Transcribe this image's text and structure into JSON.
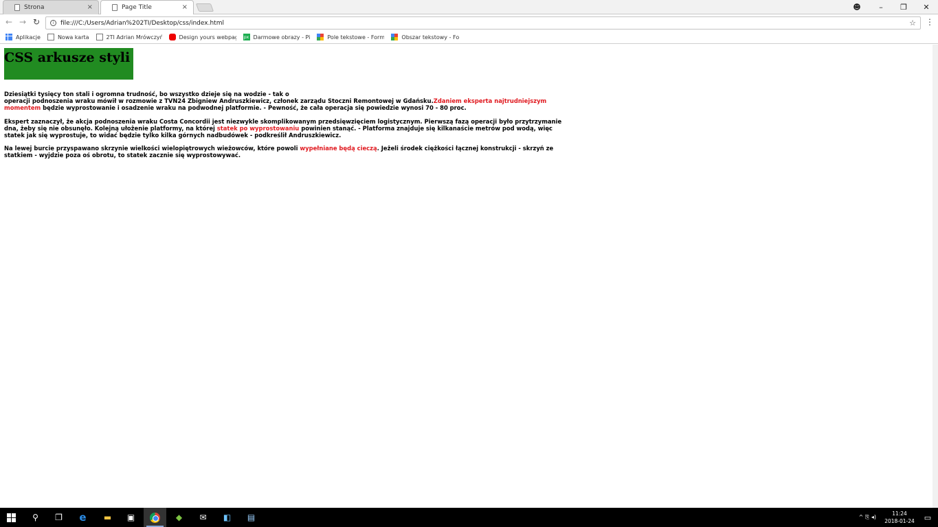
{
  "browser": {
    "tabs": [
      {
        "title": "Strona",
        "active": false
      },
      {
        "title": "Page Title",
        "active": true
      }
    ],
    "close_glyph": "×",
    "window_controls": {
      "account": "☻",
      "minimize": "–",
      "restore": "❐",
      "close": "✕"
    },
    "nav": {
      "back": "←",
      "forward": "→",
      "reload": "↻"
    },
    "address": {
      "info_glyph": "i",
      "url": "file:///C:/Users/Adrian%202TI/Desktop/css/index.html",
      "star": "☆"
    },
    "menu_glyph": "⋮",
    "bookmarks": [
      {
        "label": "Aplikacje",
        "icon": "apps-grid-icon"
      },
      {
        "label": "Nowa karta",
        "icon": "page-icon"
      },
      {
        "label": "2TI Adrian Mrówczyń",
        "icon": "page-icon"
      },
      {
        "label": "Design yours webpag",
        "icon": "youtube-icon"
      },
      {
        "label": "Darmowe obrazy - Pi",
        "icon": "pixabay-icon"
      },
      {
        "label": "Pole tekstowe - Form",
        "icon": "google-icon"
      },
      {
        "label": "Obszar tekstowy - Fo",
        "icon": "google-icon"
      }
    ]
  },
  "page": {
    "heading": "CSS arkusze styli",
    "heading_bg": "#218b21",
    "accent_red": "#e0191f",
    "paragraphs": [
      {
        "text_1": "Dziesiątki tysięcy ton stali i ogromna trudność, bo wszystko dzieje się na wodzie - tak o",
        "text_2": "operacji podnoszenia wraku mówił w rozmowie z TVN24 Zbigniew Andruszkiewicz, członek zarządu Stoczni Remontowej w Gdańsku.",
        "red": "Zdaniem eksperta najtrudniejszym momentem",
        "text_3": " będzie wyprostowanie i osadzenie wraku na podwodnej platformie. - Pewność, że cała operacja się powiedzie wynosi 70 - 80 proc."
      },
      {
        "text_1": "Ekspert zaznaczył, że akcja podnoszenia wraku Costa Concordii jest niezwykle skomplikowanym przedsięwzięciem logistycznym. Pierwszą fazą operacji było przytrzymanie dna, żeby się nie obsunęło. Kolejną ułożenie platformy, na której ",
        "red": "statek po wyprostowaniu",
        "text_2": " powinien stanąć. - Platforma znajduje się kilkanaście metrów pod wodą, więc statek jak się wyprostuje, to widać będzie tylko kilka górnych nadbudówek - podkreślił Andruszkiewicz."
      },
      {
        "text_1": "Na lewej burcie przyspawano skrzynie wielkości wielopiętrowych wieżowców, które powoli ",
        "red": "wypełniane będą cieczą",
        "text_2": ". Jeżeli środek ciężkości łącznej konstrukcji - skrzyń ze statkiem - wyjdzie poza oś obrotu, to statek zacznie się wyprostowywać."
      }
    ]
  },
  "taskbar": {
    "search_glyph": "⚲",
    "task_view_glyph": "❐",
    "edge_glyph": "e",
    "explorer_glyph": "▬",
    "store_glyph": "▣",
    "mail_glyph": "✉",
    "app1_glyph": "◧",
    "app2_glyph": "▤",
    "tray_glyphs": "^  ⎘  ◂)",
    "time": "11:24",
    "date": "2018-01-24",
    "notification_glyph": "▭"
  }
}
